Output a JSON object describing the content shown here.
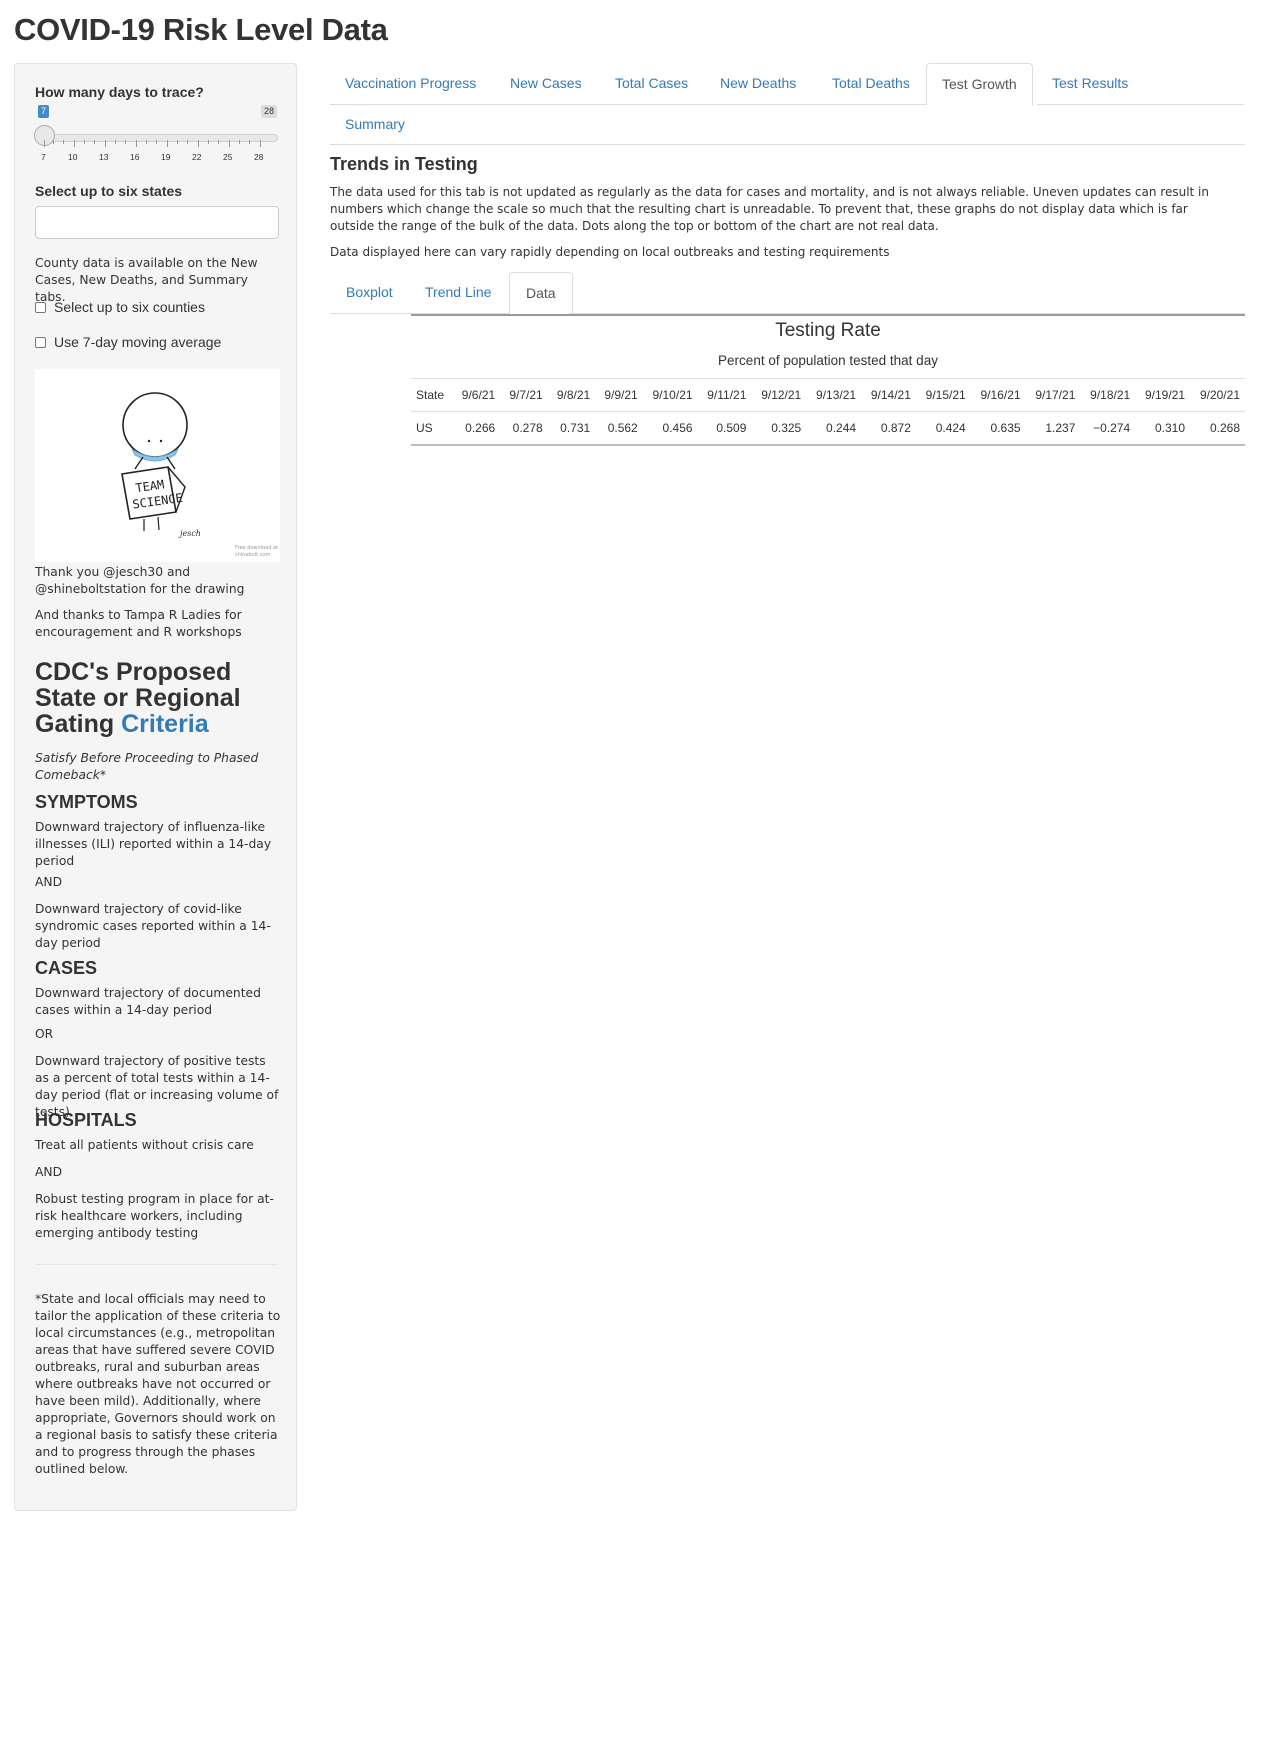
{
  "app": {
    "title": "COVID-19 Risk Level Data"
  },
  "sidebar": {
    "days_label": "How many days to trace?",
    "slider": {
      "min": 7,
      "max": 28,
      "value": 7,
      "value_label": "7",
      "max_label": "28",
      "tick_labels": [
        "7",
        "10",
        "13",
        "16",
        "19",
        "22",
        "25",
        "28"
      ]
    },
    "states_label": "Select up to six states",
    "states_input_value": "",
    "county_note": "County data is available on the New Cases, New Deaths, and Summary tabs.",
    "checkbox_counties": {
      "label": "Select up to six counties",
      "checked": false
    },
    "checkbox_moving_avg": {
      "label": "Use 7-day moving average",
      "checked": false
    },
    "drawing": {
      "sign_line1": "TEAM",
      "sign_line2": "SCIENCE",
      "signature": "jesch",
      "credit1": "Free download at",
      "credit2": "shinebolt.com"
    },
    "thanks1": "Thank you @jesch30 and @shineboltstation for the drawing",
    "thanks2": "And thanks to Tampa R Ladies for encouragement and R workshops",
    "cdc": {
      "heading_line1": "CDC's Proposed",
      "heading_line2": "State or Regional",
      "heading_line3_text": "Gating",
      "heading_link": "Criteria",
      "subtitle": "Satisfy Before Proceeding to Phased Comeback*",
      "symptoms_h": "SYMPTOMS",
      "symptoms_1": "Downward trajectory of influenza-like illnesses (ILI) reported within a 14-day period",
      "and1": "AND",
      "symptoms_2": "Downward trajectory of covid-like syndromic cases reported within a 14-day period",
      "cases_h": "CASES",
      "cases_1": "Downward trajectory of documented cases within a 14-day period",
      "or1": "OR",
      "cases_2": "Downward trajectory of positive tests as a percent of total tests within a 14-day period (flat or increasing volume of tests)",
      "hospitals_h": "HOSPITALS",
      "hospitals_1": "Treat all patients without crisis care",
      "and2": "AND",
      "hospitals_2": "Robust testing program in place for at-risk healthcare workers, including emerging antibody testing",
      "footnote": "*State and local officials may need to tailor the application of these criteria to local circumstances (e.g., metropolitan areas that have suffered severe COVID outbreaks, rural and suburban areas where outbreaks have not occurred or have been mild). Additionally, where appropriate, Governors should work on a regional basis to satisfy these criteria and to progress through the phases outlined below."
    }
  },
  "main": {
    "tabs": [
      "Vaccination Progress",
      "New Cases",
      "Total Cases",
      "New Deaths",
      "Total Deaths",
      "Test Growth",
      "Test Results",
      "Summary"
    ],
    "active_tab": "Test Growth",
    "section_title": "Trends in Testing",
    "paragraph1": "The data used for this tab is not updated as regularly as the data for cases and mortality, and is not always reliable. Uneven updates can result in numbers which change the scale so much that the resulting chart is unreadable. To prevent that, these graphs do not display data which is far outside the range of the bulk of the data. Dots along the top or bottom of the chart are not real data.",
    "paragraph2": "Data displayed here can vary rapidly depending on local outbreaks and testing requirements",
    "subtabs": [
      "Boxplot",
      "Trend Line",
      "Data"
    ],
    "active_subtab": "Data",
    "table": {
      "title": "Testing Rate",
      "subtitle": "Percent of population tested that day",
      "headers": [
        "State",
        "9/6/21",
        "9/7/21",
        "9/8/21",
        "9/9/21",
        "9/10/21",
        "9/11/21",
        "9/12/21",
        "9/13/21",
        "9/14/21",
        "9/15/21",
        "9/16/21",
        "9/17/21",
        "9/18/21",
        "9/19/21",
        "9/20/21"
      ],
      "rows": [
        [
          "US",
          "0.266",
          "0.278",
          "0.731",
          "0.562",
          "0.456",
          "0.509",
          "0.325",
          "0.244",
          "0.872",
          "0.424",
          "0.635",
          "1.237",
          "−0.274",
          "0.310",
          "0.268"
        ]
      ]
    }
  },
  "colors": {
    "link": "#337ab7",
    "sidebar_bg": "#f5f5f5",
    "slider_badge": "#428bca",
    "mask": "#8fc3e8"
  }
}
